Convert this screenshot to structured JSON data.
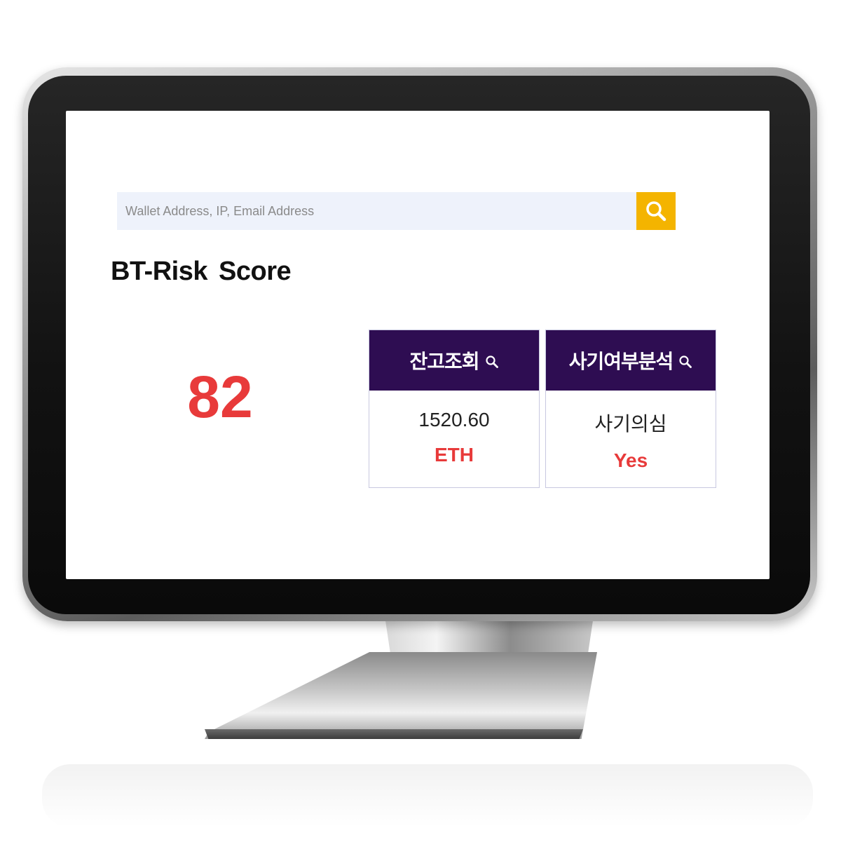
{
  "search": {
    "placeholder": "Wallet Address, IP, Email Address",
    "icon": "search-icon"
  },
  "title": "BT-Risk  Score",
  "risk_score": "82",
  "cards": [
    {
      "header": "잔고조회",
      "icon": "search-icon",
      "value": "1520.60",
      "sub": "ETH"
    },
    {
      "header": "사기여부분석",
      "icon": "search-icon",
      "value": "사기의심",
      "sub": "Yes"
    }
  ],
  "colors": {
    "accent": "#f4b400",
    "header_bg": "#2e0d52",
    "highlight": "#e83a3a",
    "search_bg": "#eef2fb"
  }
}
